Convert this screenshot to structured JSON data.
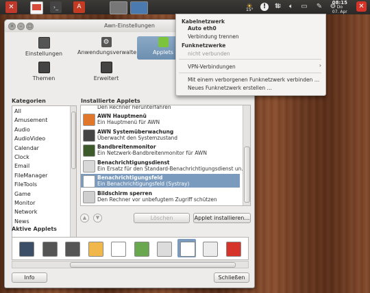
{
  "topbar": {
    "dock_icons": [
      {
        "name": "terminal-icon",
        "color": "#c0392b"
      },
      {
        "name": "presentation-icon",
        "color": "#d84a3a"
      },
      {
        "name": "terminal-2-icon",
        "color": "#444444"
      },
      {
        "name": "ubuntu-software-icon",
        "color": "#c23b22"
      },
      {
        "name": "window-icon",
        "color": "#666666"
      },
      {
        "name": "display-icon",
        "color": "#4a7ab0"
      }
    ],
    "weather_temp": "15°",
    "clock_time": "08:15",
    "clock_day": "Do",
    "clock_date": "07. Apr"
  },
  "window": {
    "title": "Awn-Einstellungen",
    "categories": [
      {
        "label": "Einstellungen"
      },
      {
        "label": "Anwendungsverwalter"
      },
      {
        "label": "Applets"
      },
      {
        "label": "Themen"
      },
      {
        "label": "Erweitert"
      }
    ],
    "kategorien_label": "Kategorien",
    "kategorien": [
      "All",
      "Amusement",
      "Audio",
      "AudioVideo",
      "Calendar",
      "Clock",
      "Email",
      "FileManager",
      "FileTools",
      "Game",
      "Monitor",
      "Network",
      "News"
    ],
    "installed_label": "Installierte Applets",
    "installed_partial": "Den Rechner herunterfahren",
    "applets": [
      {
        "name": "AWN Hauptmenü",
        "desc": "Ein Hauptmenü für AWN",
        "icon_color": "#e0772a"
      },
      {
        "name": "AWN Systemüberwachung",
        "desc": "Überwacht den Systemzustand",
        "icon_color": "#444444"
      },
      {
        "name": "Bandbreitenmonitor",
        "desc": "Ein Netzwerk-Bandbreitenmonitor für AWN",
        "icon_color": "#3d5a2a"
      },
      {
        "name": "Benachrichtigungsdienst",
        "desc": "Ein Ersatz für den Standard-Benachrichtigungsdienst un…",
        "icon_color": "#d8d8d8"
      },
      {
        "name": "Benachrichtigungsfeld",
        "desc": "Ein Benachrichtigungsfeld (Systray)",
        "icon_color": "#ffffff",
        "selected": true
      },
      {
        "name": "Bildschirm sperren",
        "desc": "Den Rechner vor unbefugtem Zugriff schützen",
        "icon_color": "#cfcfcf"
      }
    ],
    "delete_button": "Löschen",
    "install_button": "Applet installieren…",
    "active_label": "Aktive Applets",
    "active_icons": [
      {
        "name": "cpu-icon",
        "color": "#3b5068"
      },
      {
        "name": "stack-icon",
        "color": "#555555"
      },
      {
        "name": "stack-2-icon",
        "color": "#555555"
      },
      {
        "name": "weather-icon",
        "color": "#f0b84a"
      },
      {
        "name": "speech-icon",
        "color": "#ffffff"
      },
      {
        "name": "info-icon",
        "color": "#6aa84f"
      },
      {
        "name": "tray-icon",
        "color": "#dcdcdc"
      },
      {
        "name": "clock-icon",
        "color": "#ffffff",
        "selected": true
      },
      {
        "name": "blank-icon",
        "color": "#ececec"
      },
      {
        "name": "shutdown-icon",
        "color": "#d6342b"
      }
    ],
    "info_button": "Info",
    "close_button": "Schließen"
  },
  "network_menu": {
    "wired_header": "Kabelnetzwerk",
    "wired_conn": "Auto eth0",
    "disconnect": "Verbindung trennen",
    "wireless_header": "Funknetzwerke",
    "wireless_status": "nicht verbunden",
    "vpn": "VPN-Verbindungen",
    "hidden_network": "Mit einem verborgenen Funknetzwerk verbinden …",
    "new_network": "Neues Funknetzwerk erstellen …"
  }
}
